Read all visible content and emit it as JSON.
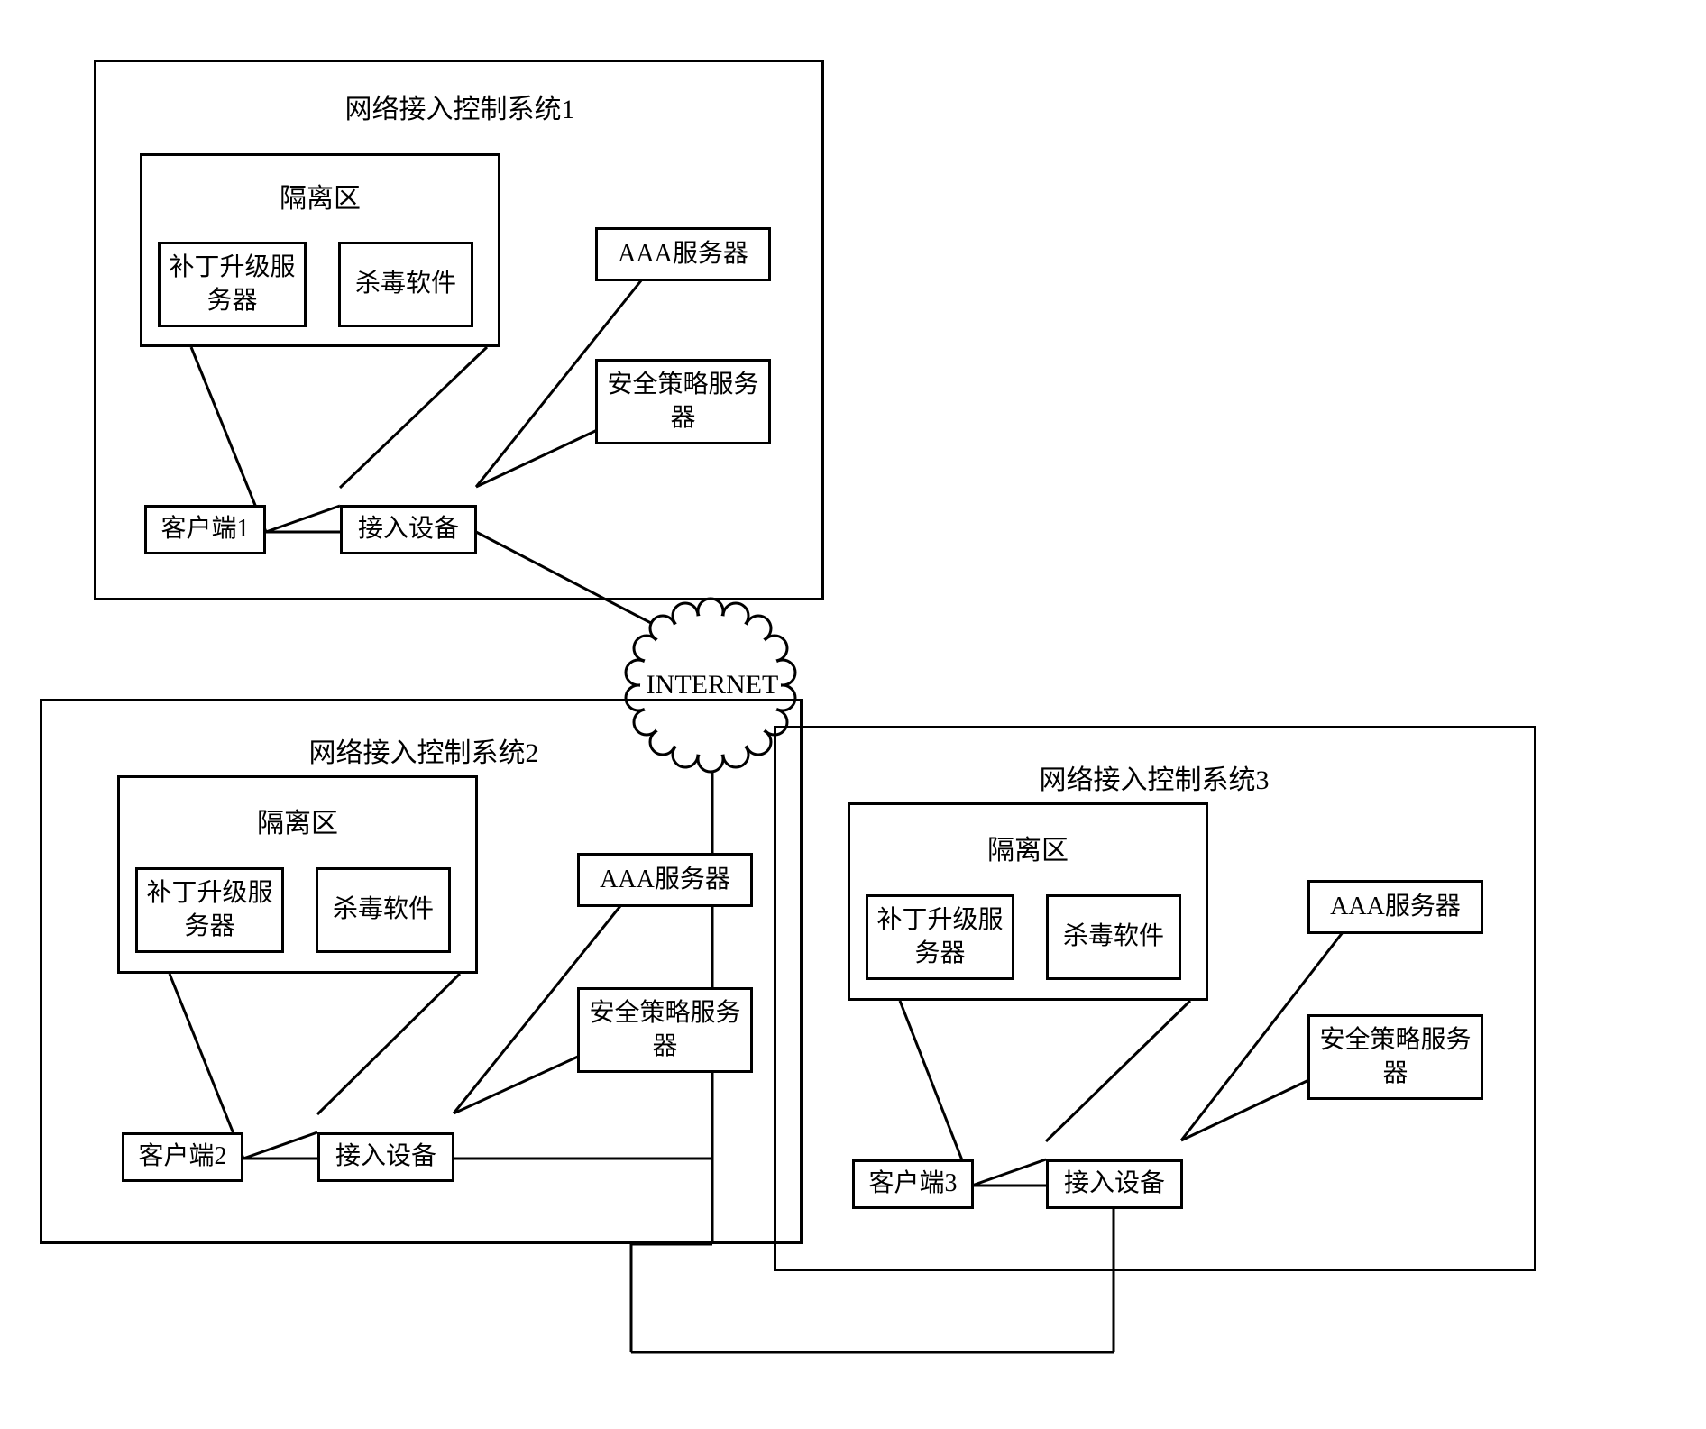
{
  "systems": {
    "s1": {
      "title": "网络接入控制系统1",
      "dmz_label": "隔离区",
      "patch_server": "补丁升级服务器",
      "antivirus": "杀毒软件",
      "aaa": "AAA服务器",
      "policy": "安全策略服务器",
      "client": "客户端1",
      "access": "接入设备"
    },
    "s2": {
      "title": "网络接入控制系统2",
      "dmz_label": "隔离区",
      "patch_server": "补丁升级服务器",
      "antivirus": "杀毒软件",
      "aaa": "AAA服务器",
      "policy": "安全策略服务器",
      "client": "客户端2",
      "access": "接入设备"
    },
    "s3": {
      "title": "网络接入控制系统3",
      "dmz_label": "隔离区",
      "patch_server": "补丁升级服务器",
      "antivirus": "杀毒软件",
      "aaa": "AAA服务器",
      "policy": "安全策略服务器",
      "client": "客户端3",
      "access": "接入设备"
    }
  },
  "cloud": "INTERNET"
}
